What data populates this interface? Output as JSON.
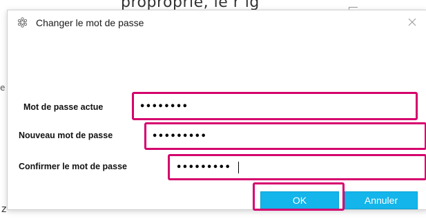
{
  "background": {
    "top_text": "proproprié, ie r ig",
    "left_text": "e",
    "bottom_left_text": "z"
  },
  "dialog": {
    "title": "Changer le mot de passe",
    "app_icon": "gear-cluster-icon",
    "close_icon": "close-icon"
  },
  "form": {
    "current_password": {
      "label": "Mot de passe actue",
      "value": "••••••••"
    },
    "new_password": {
      "label": "Nouveau mot de passe",
      "value": "•••••••••"
    },
    "confirm_password": {
      "label": "Confirmer le mot de passe",
      "value": "•••••••••"
    }
  },
  "buttons": {
    "ok_label": "OK",
    "cancel_label": "Annuler"
  },
  "colors": {
    "highlight": "#d5006d",
    "button": "#13b5ea"
  }
}
